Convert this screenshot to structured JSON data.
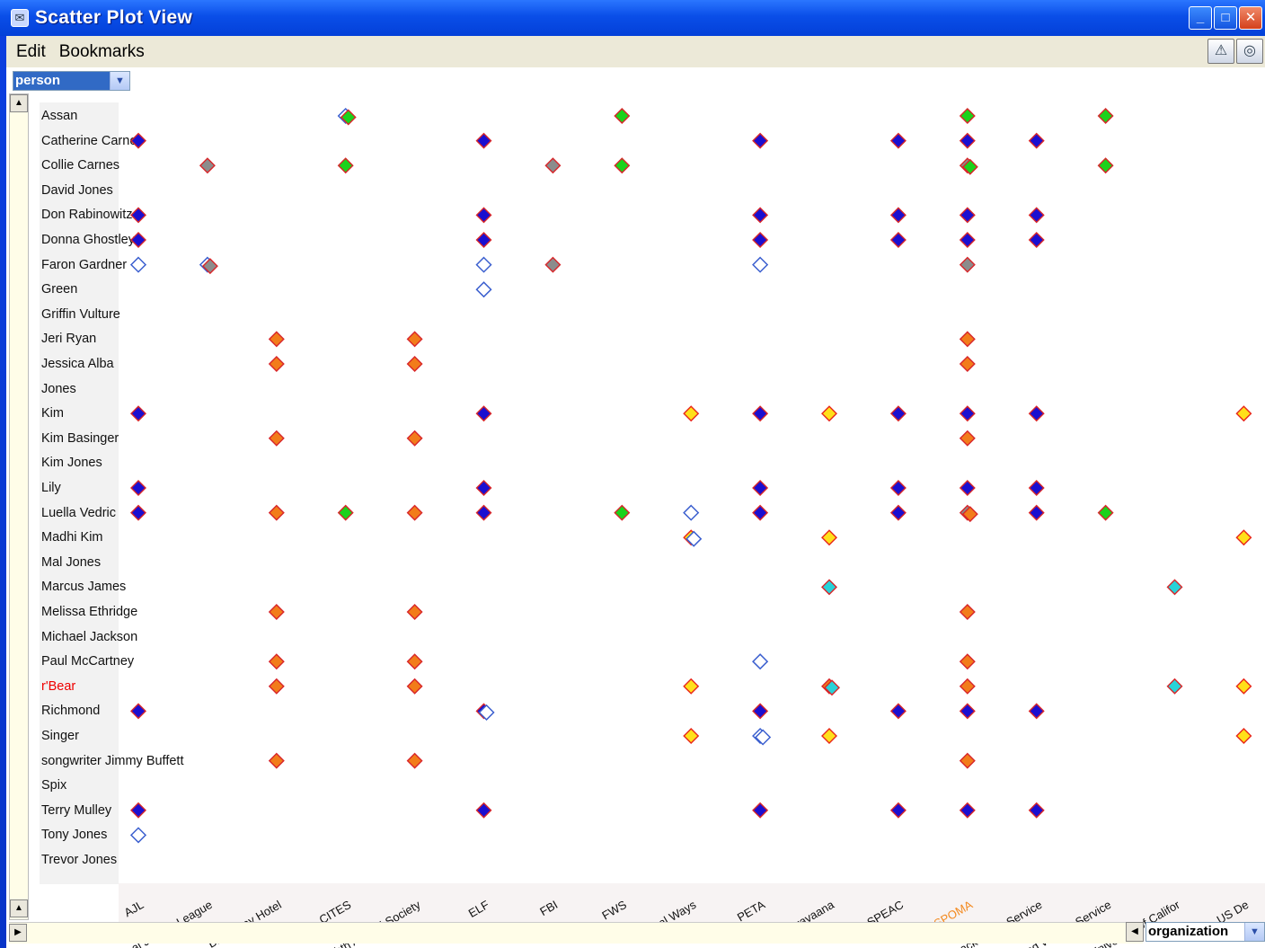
{
  "window": {
    "title": "Scatter Plot View"
  },
  "menu": {
    "edit": "Edit",
    "bookmarks": "Bookmarks"
  },
  "selectors": {
    "y_axis": "person",
    "x_axis": "organization"
  },
  "legend_colors": {
    "blue": "#1a0fd0",
    "green": "#1bd21b",
    "gray": "#8c8c8c",
    "orange": "#f27c1a",
    "yellow": "#ffe01a",
    "cyan": "#28d2d8",
    "blue-outline": "#3b5fcf"
  },
  "chart_data": {
    "type": "scatter",
    "x_axis_field": "organization",
    "y_axis_field": "person",
    "highlight_person": "r'Bear",
    "highlight_organization": "SPOMA",
    "organizations": [
      "AJL",
      "Animal Justice League",
      "Broadway Hotel",
      "CITES",
      "Eighth Annual Society",
      "ELF",
      "FBI",
      "FWS",
      "Global Ways",
      "PETA",
      "Shravaana",
      "SPEAC",
      "SPOMA",
      "Tamarack News Service",
      "U.S. Fish and Wildlife Service",
      "University of California",
      "US Dept"
    ],
    "organization_labels": [
      "AJL",
      "Animal Justice League",
      "Broadway Hotel",
      "CITES",
      "Eighth Annual Society",
      "ELF",
      "FBI",
      "FWS",
      "Global Ways",
      "PETA",
      "Shravaana",
      "SPEAC",
      "SPOMA",
      "Tamarack News Service",
      "U.S. Fish and Wildlife Service",
      "University of Califor",
      "US De"
    ],
    "persons": [
      "Assan",
      "Catherine Carnes",
      "Collie Carnes",
      "David Jones",
      "Don Rabinowitz",
      "Donna Ghostley",
      "Faron Gardner",
      "Green",
      "Griffin Vulture",
      "Jeri Ryan",
      "Jessica Alba",
      "Jones",
      "Kim",
      "Kim Basinger",
      "Kim Jones",
      "Lily",
      "Luella Vedric",
      "Madhi Kim",
      "Mal Jones",
      "Marcus James",
      "Melissa Ethridge",
      "Michael Jackson",
      "Paul McCartney",
      "r'Bear",
      "Richmond",
      "Singer",
      "songwriter Jimmy Buffett",
      "Spix",
      "Terry Mulley",
      "Tony Jones",
      "Trevor Jones"
    ],
    "person_labels": [
      "Assan",
      "Catherine Carne",
      "Collie Carnes",
      "David Jones",
      "Don Rabinowitz",
      "Donna Ghostley",
      "Faron Gardner",
      "Green",
      "Griffin Vulture",
      "Jeri Ryan",
      "Jessica Alba",
      "Jones",
      "Kim",
      "Kim Basinger",
      "Kim Jones",
      "Lily",
      "Luella Vedric",
      "Madhi Kim",
      "Mal Jones",
      "Marcus James",
      "Melissa Ethridge",
      "Michael Jackson",
      "Paul McCartney",
      "r'Bear",
      "Richmond",
      "Singer",
      "songwriter Jimmy Buffett",
      "Spix",
      "Terry Mulley",
      "Tony Jones",
      "Trevor Jones"
    ],
    "points": [
      [
        "Assan",
        "CITES",
        "blue-outline"
      ],
      [
        "Assan",
        "CITES",
        "green"
      ],
      [
        "Assan",
        "FWS",
        "green"
      ],
      [
        "Assan",
        "SPOMA",
        "green"
      ],
      [
        "Assan",
        "U.S. Fish and Wildlife Service",
        "green"
      ],
      [
        "Catherine Carnes",
        "AJL",
        "blue"
      ],
      [
        "Catherine Carnes",
        "ELF",
        "blue"
      ],
      [
        "Catherine Carnes",
        "PETA",
        "blue"
      ],
      [
        "Catherine Carnes",
        "SPEAC",
        "blue"
      ],
      [
        "Catherine Carnes",
        "SPOMA",
        "blue"
      ],
      [
        "Catherine Carnes",
        "Tamarack News Service",
        "blue"
      ],
      [
        "Collie Carnes",
        "Animal Justice League",
        "gray"
      ],
      [
        "Collie Carnes",
        "CITES",
        "green"
      ],
      [
        "Collie Carnes",
        "FBI",
        "gray"
      ],
      [
        "Collie Carnes",
        "FWS",
        "green"
      ],
      [
        "Collie Carnes",
        "SPOMA",
        "gray"
      ],
      [
        "Collie Carnes",
        "SPOMA",
        "green"
      ],
      [
        "Collie Carnes",
        "U.S. Fish and Wildlife Service",
        "green"
      ],
      [
        "Don Rabinowitz",
        "AJL",
        "blue"
      ],
      [
        "Don Rabinowitz",
        "ELF",
        "blue"
      ],
      [
        "Don Rabinowitz",
        "PETA",
        "blue"
      ],
      [
        "Don Rabinowitz",
        "SPEAC",
        "blue"
      ],
      [
        "Don Rabinowitz",
        "SPOMA",
        "blue"
      ],
      [
        "Don Rabinowitz",
        "Tamarack News Service",
        "blue"
      ],
      [
        "Donna Ghostley",
        "AJL",
        "blue"
      ],
      [
        "Donna Ghostley",
        "ELF",
        "blue"
      ],
      [
        "Donna Ghostley",
        "PETA",
        "blue"
      ],
      [
        "Donna Ghostley",
        "SPEAC",
        "blue"
      ],
      [
        "Donna Ghostley",
        "SPOMA",
        "blue"
      ],
      [
        "Donna Ghostley",
        "Tamarack News Service",
        "blue"
      ],
      [
        "Faron Gardner",
        "AJL",
        "blue-outline"
      ],
      [
        "Faron Gardner",
        "Animal Justice League",
        "blue-outline"
      ],
      [
        "Faron Gardner",
        "Animal Justice League",
        "gray"
      ],
      [
        "Faron Gardner",
        "ELF",
        "blue-outline"
      ],
      [
        "Faron Gardner",
        "FBI",
        "gray"
      ],
      [
        "Faron Gardner",
        "PETA",
        "blue-outline"
      ],
      [
        "Faron Gardner",
        "SPOMA",
        "gray"
      ],
      [
        "Green",
        "ELF",
        "blue-outline"
      ],
      [
        "Jeri Ryan",
        "Broadway Hotel",
        "orange"
      ],
      [
        "Jeri Ryan",
        "Eighth Annual Society",
        "orange"
      ],
      [
        "Jeri Ryan",
        "SPOMA",
        "orange"
      ],
      [
        "Jessica Alba",
        "Broadway Hotel",
        "orange"
      ],
      [
        "Jessica Alba",
        "Eighth Annual Society",
        "orange"
      ],
      [
        "Jessica Alba",
        "SPOMA",
        "orange"
      ],
      [
        "Kim",
        "AJL",
        "blue"
      ],
      [
        "Kim",
        "ELF",
        "blue"
      ],
      [
        "Kim",
        "Global Ways",
        "yellow"
      ],
      [
        "Kim",
        "PETA",
        "blue"
      ],
      [
        "Kim",
        "Shravaana",
        "yellow"
      ],
      [
        "Kim",
        "SPEAC",
        "blue"
      ],
      [
        "Kim",
        "SPOMA",
        "blue"
      ],
      [
        "Kim",
        "Tamarack News Service",
        "blue"
      ],
      [
        "Kim",
        "US Dept",
        "yellow"
      ],
      [
        "Kim Basinger",
        "Broadway Hotel",
        "orange"
      ],
      [
        "Kim Basinger",
        "Eighth Annual Society",
        "orange"
      ],
      [
        "Kim Basinger",
        "SPOMA",
        "orange"
      ],
      [
        "Lily",
        "AJL",
        "blue"
      ],
      [
        "Lily",
        "ELF",
        "blue"
      ],
      [
        "Lily",
        "PETA",
        "blue"
      ],
      [
        "Lily",
        "SPEAC",
        "blue"
      ],
      [
        "Lily",
        "SPOMA",
        "blue"
      ],
      [
        "Lily",
        "Tamarack News Service",
        "blue"
      ],
      [
        "Luella Vedric",
        "AJL",
        "blue"
      ],
      [
        "Luella Vedric",
        "Broadway Hotel",
        "orange"
      ],
      [
        "Luella Vedric",
        "CITES",
        "green"
      ],
      [
        "Luella Vedric",
        "Eighth Annual Society",
        "orange"
      ],
      [
        "Luella Vedric",
        "ELF",
        "blue"
      ],
      [
        "Luella Vedric",
        "FWS",
        "green"
      ],
      [
        "Luella Vedric",
        "Global Ways",
        "blue-outline"
      ],
      [
        "Luella Vedric",
        "PETA",
        "blue"
      ],
      [
        "Luella Vedric",
        "SPEAC",
        "blue"
      ],
      [
        "Luella Vedric",
        "SPOMA",
        "gray"
      ],
      [
        "Luella Vedric",
        "SPOMA",
        "orange"
      ],
      [
        "Luella Vedric",
        "Tamarack News Service",
        "blue"
      ],
      [
        "Luella Vedric",
        "U.S. Fish and Wildlife Service",
        "green"
      ],
      [
        "Madhi Kim",
        "Global Ways",
        "yellow"
      ],
      [
        "Madhi Kim",
        "Global Ways",
        "blue-outline"
      ],
      [
        "Madhi Kim",
        "Shravaana",
        "yellow"
      ],
      [
        "Madhi Kim",
        "US Dept",
        "yellow"
      ],
      [
        "Marcus James",
        "Shravaana",
        "cyan"
      ],
      [
        "Marcus James",
        "University of California",
        "cyan"
      ],
      [
        "Melissa Ethridge",
        "Broadway Hotel",
        "orange"
      ],
      [
        "Melissa Ethridge",
        "Eighth Annual Society",
        "orange"
      ],
      [
        "Melissa Ethridge",
        "SPOMA",
        "orange"
      ],
      [
        "Paul McCartney",
        "Broadway Hotel",
        "orange"
      ],
      [
        "Paul McCartney",
        "Eighth Annual Society",
        "orange"
      ],
      [
        "Paul McCartney",
        "PETA",
        "blue-outline"
      ],
      [
        "Paul McCartney",
        "SPOMA",
        "orange"
      ],
      [
        "r'Bear",
        "Broadway Hotel",
        "orange"
      ],
      [
        "r'Bear",
        "Eighth Annual Society",
        "orange"
      ],
      [
        "r'Bear",
        "Global Ways",
        "yellow"
      ],
      [
        "r'Bear",
        "Shravaana",
        "orange"
      ],
      [
        "r'Bear",
        "Shravaana",
        "cyan"
      ],
      [
        "r'Bear",
        "SPOMA",
        "orange"
      ],
      [
        "r'Bear",
        "University of California",
        "cyan"
      ],
      [
        "r'Bear",
        "US Dept",
        "yellow"
      ],
      [
        "Richmond",
        "AJL",
        "blue"
      ],
      [
        "Richmond",
        "ELF",
        "blue"
      ],
      [
        "Richmond",
        "ELF",
        "blue-outline"
      ],
      [
        "Richmond",
        "PETA",
        "blue"
      ],
      [
        "Richmond",
        "SPEAC",
        "blue"
      ],
      [
        "Richmond",
        "SPOMA",
        "blue"
      ],
      [
        "Richmond",
        "Tamarack News Service",
        "blue"
      ],
      [
        "Singer",
        "Global Ways",
        "yellow"
      ],
      [
        "Singer",
        "PETA",
        "blue-outline"
      ],
      [
        "Singer",
        "PETA",
        "blue-outline"
      ],
      [
        "Singer",
        "Shravaana",
        "yellow"
      ],
      [
        "Singer",
        "US Dept",
        "yellow"
      ],
      [
        "songwriter Jimmy Buffett",
        "Broadway Hotel",
        "orange"
      ],
      [
        "songwriter Jimmy Buffett",
        "Eighth Annual Society",
        "orange"
      ],
      [
        "songwriter Jimmy Buffett",
        "SPOMA",
        "orange"
      ],
      [
        "Terry Mulley",
        "AJL",
        "blue"
      ],
      [
        "Terry Mulley",
        "ELF",
        "blue"
      ],
      [
        "Terry Mulley",
        "PETA",
        "blue"
      ],
      [
        "Terry Mulley",
        "SPEAC",
        "blue"
      ],
      [
        "Terry Mulley",
        "SPOMA",
        "blue"
      ],
      [
        "Terry Mulley",
        "Tamarack News Service",
        "blue"
      ],
      [
        "Tony Jones",
        "AJL",
        "blue-outline"
      ]
    ]
  }
}
